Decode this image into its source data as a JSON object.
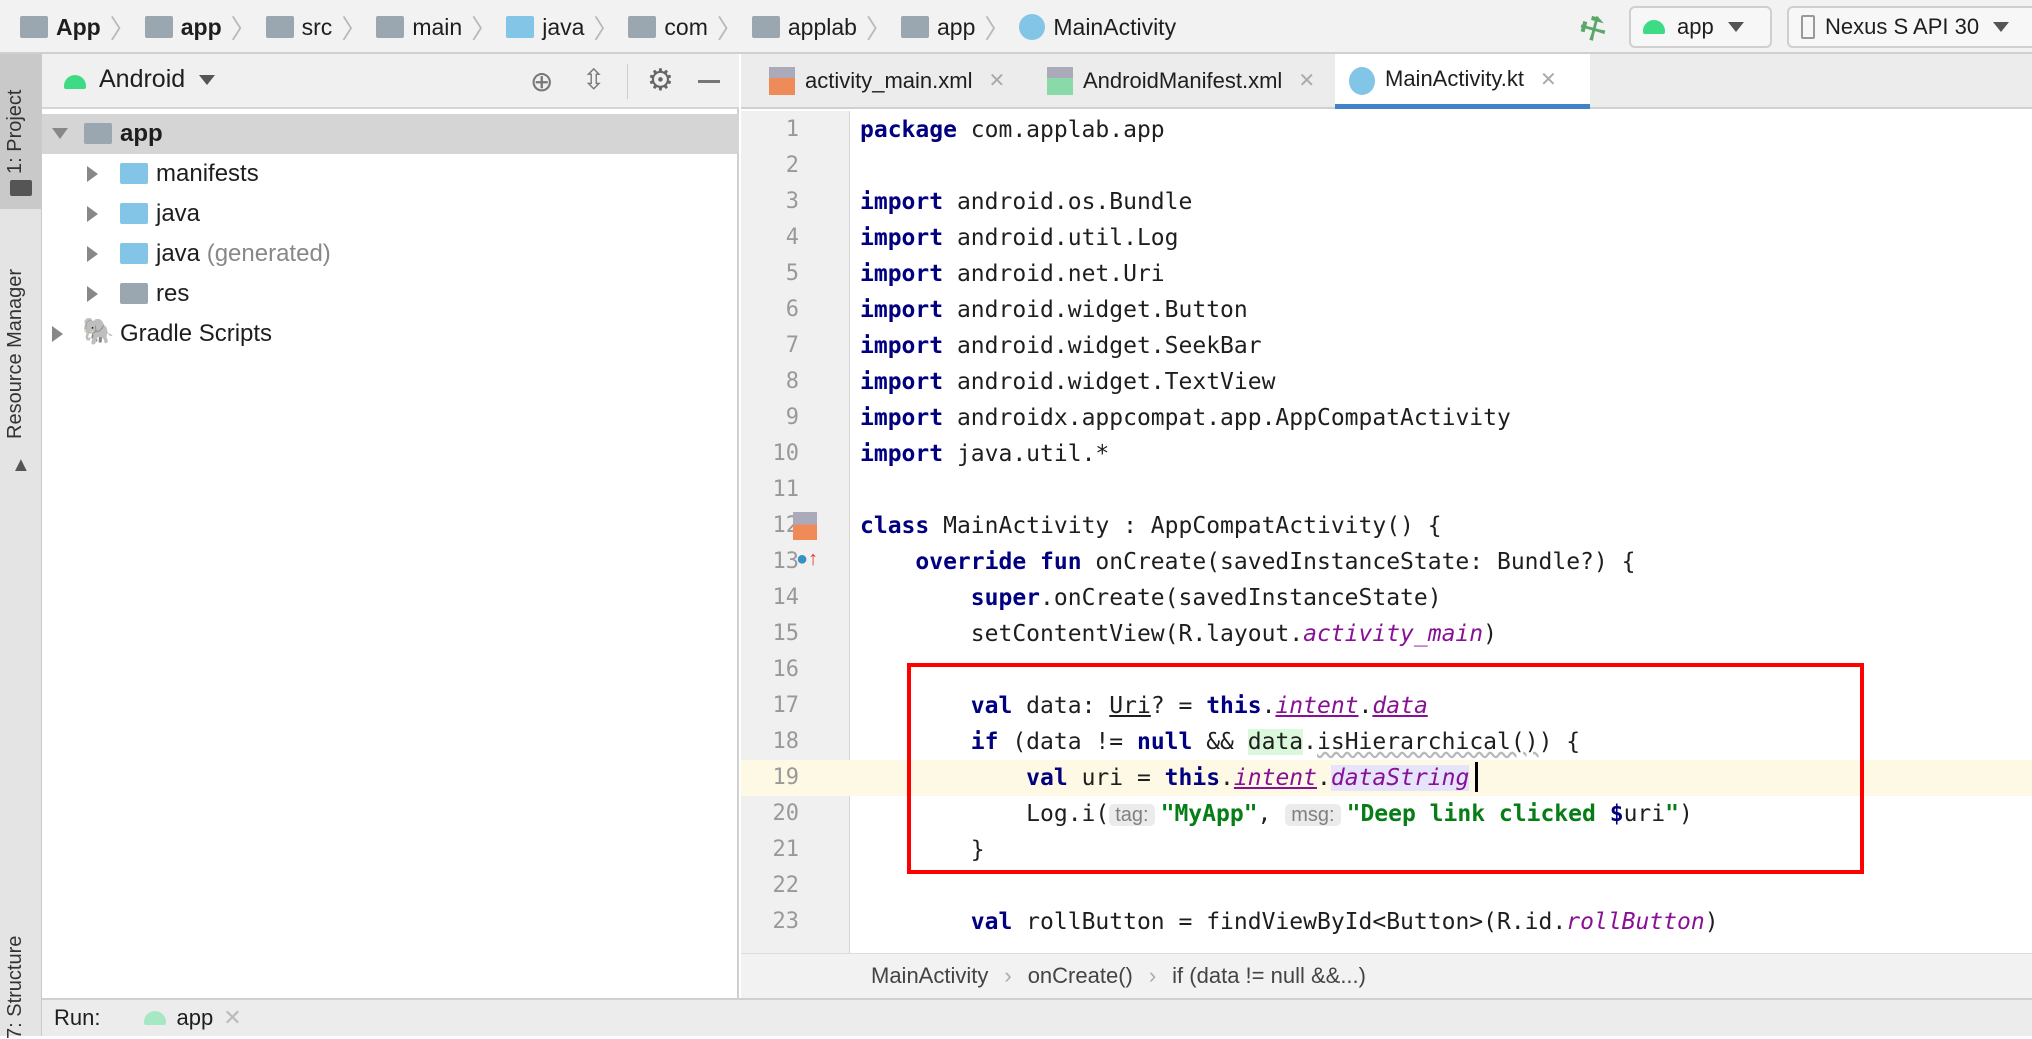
{
  "breadcrumb": [
    "App",
    "app",
    "src",
    "main",
    "java",
    "com",
    "applab",
    "app",
    "MainActivity"
  ],
  "toolbar": {
    "run_config": "app",
    "device": "Nexus S API 30"
  },
  "left_strip": {
    "project": "1: Project",
    "resource_manager": "Resource Manager",
    "structure": "7: Structure"
  },
  "project_panel": {
    "view_mode": "Android",
    "tree": [
      {
        "label": "app",
        "level": 0,
        "expanded": true,
        "selected": true
      },
      {
        "label": "manifests",
        "level": 1
      },
      {
        "label": "java",
        "level": 1
      },
      {
        "label": "java",
        "suffix": "(generated)",
        "level": 1
      },
      {
        "label": "res",
        "level": 1
      },
      {
        "label": "Gradle Scripts",
        "level": 0
      }
    ]
  },
  "tabs": [
    {
      "label": "activity_main.xml",
      "active": false
    },
    {
      "label": "AndroidManifest.xml",
      "active": false
    },
    {
      "label": "MainActivity.kt",
      "active": true
    }
  ],
  "editor": {
    "current_line": 19,
    "highlight_color": "#ff0000",
    "lines": [
      [
        [
          "package",
          "k"
        ],
        [
          " com.applab.app",
          "p"
        ]
      ],
      [],
      [
        [
          "import",
          "k"
        ],
        [
          " android.os.Bundle",
          "p"
        ]
      ],
      [
        [
          "import",
          "k"
        ],
        [
          " android.util.Log",
          "p"
        ]
      ],
      [
        [
          "import",
          "k"
        ],
        [
          " android.net.Uri",
          "p"
        ]
      ],
      [
        [
          "import",
          "k"
        ],
        [
          " android.widget.Button",
          "p"
        ]
      ],
      [
        [
          "import",
          "k"
        ],
        [
          " android.widget.SeekBar",
          "p"
        ]
      ],
      [
        [
          "import",
          "k"
        ],
        [
          " android.widget.TextView",
          "p"
        ]
      ],
      [
        [
          "import",
          "k"
        ],
        [
          " androidx.appcompat.app.AppCompatActivity",
          "p"
        ]
      ],
      [
        [
          "import",
          "k"
        ],
        [
          " java.util.*",
          "p"
        ]
      ],
      [],
      [
        [
          "class",
          "k"
        ],
        [
          " MainActivity : AppCompatActivity() {",
          "p"
        ]
      ],
      [
        [
          "    ",
          "p"
        ],
        [
          "override fun",
          "k"
        ],
        [
          " onCreate(savedInstanceState: Bundle?) {",
          "p"
        ]
      ],
      [
        [
          "        ",
          "p"
        ],
        [
          "super",
          "k"
        ],
        [
          ".onCreate(savedInstanceState)",
          "p"
        ]
      ],
      [
        [
          "        setContentView(R.layout.",
          "p"
        ],
        [
          "activity_main",
          "f"
        ],
        [
          ")",
          "p"
        ]
      ],
      [],
      [
        [
          "        ",
          "p"
        ],
        [
          "val",
          "k"
        ],
        [
          " data: ",
          "p"
        ],
        [
          "Uri",
          "u"
        ],
        [
          "? = ",
          "p"
        ],
        [
          "this",
          "k"
        ],
        [
          ".",
          "p"
        ],
        [
          "intent",
          "fu"
        ],
        [
          ".",
          "p"
        ],
        [
          "data",
          "fu"
        ]
      ],
      [
        [
          "        ",
          "p"
        ],
        [
          "if",
          "k"
        ],
        [
          " (data != ",
          "p"
        ],
        [
          "null",
          "k"
        ],
        [
          " && ",
          "p"
        ],
        [
          "data",
          "g"
        ],
        [
          ".",
          "p"
        ],
        [
          "isHierarchical()",
          "wv"
        ],
        [
          ") {",
          "p"
        ]
      ],
      [
        [
          "            ",
          "p"
        ],
        [
          "val",
          "k"
        ],
        [
          " uri = ",
          "p"
        ],
        [
          "this",
          "k"
        ],
        [
          ".",
          "p"
        ],
        [
          "intent",
          "fu"
        ],
        [
          ".",
          "p"
        ],
        [
          "dataString",
          "ds"
        ]
      ],
      [
        [
          "            Log.i(",
          "p"
        ],
        [
          "tag:",
          "h"
        ],
        [
          "\"MyApp\"",
          "s"
        ],
        [
          ", ",
          "p"
        ],
        [
          "msg:",
          "h"
        ],
        [
          "\"Deep link clicked ",
          "s"
        ],
        [
          "$",
          "k"
        ],
        [
          "uri",
          "p"
        ],
        [
          "\"",
          "s"
        ],
        [
          ")",
          "p"
        ]
      ],
      [
        [
          "        }",
          "p"
        ]
      ],
      [],
      [
        [
          "        ",
          "p"
        ],
        [
          "val",
          "k"
        ],
        [
          " rollButton = findViewById<Button>(R.id.",
          "p"
        ],
        [
          "rollButton",
          "f"
        ],
        [
          ")",
          "p"
        ]
      ]
    ]
  },
  "editor_breadcrumb": [
    "MainActivity",
    "onCreate()",
    "if (data != null &&...)"
  ],
  "run_bar": {
    "label": "Run:",
    "config": "app"
  }
}
